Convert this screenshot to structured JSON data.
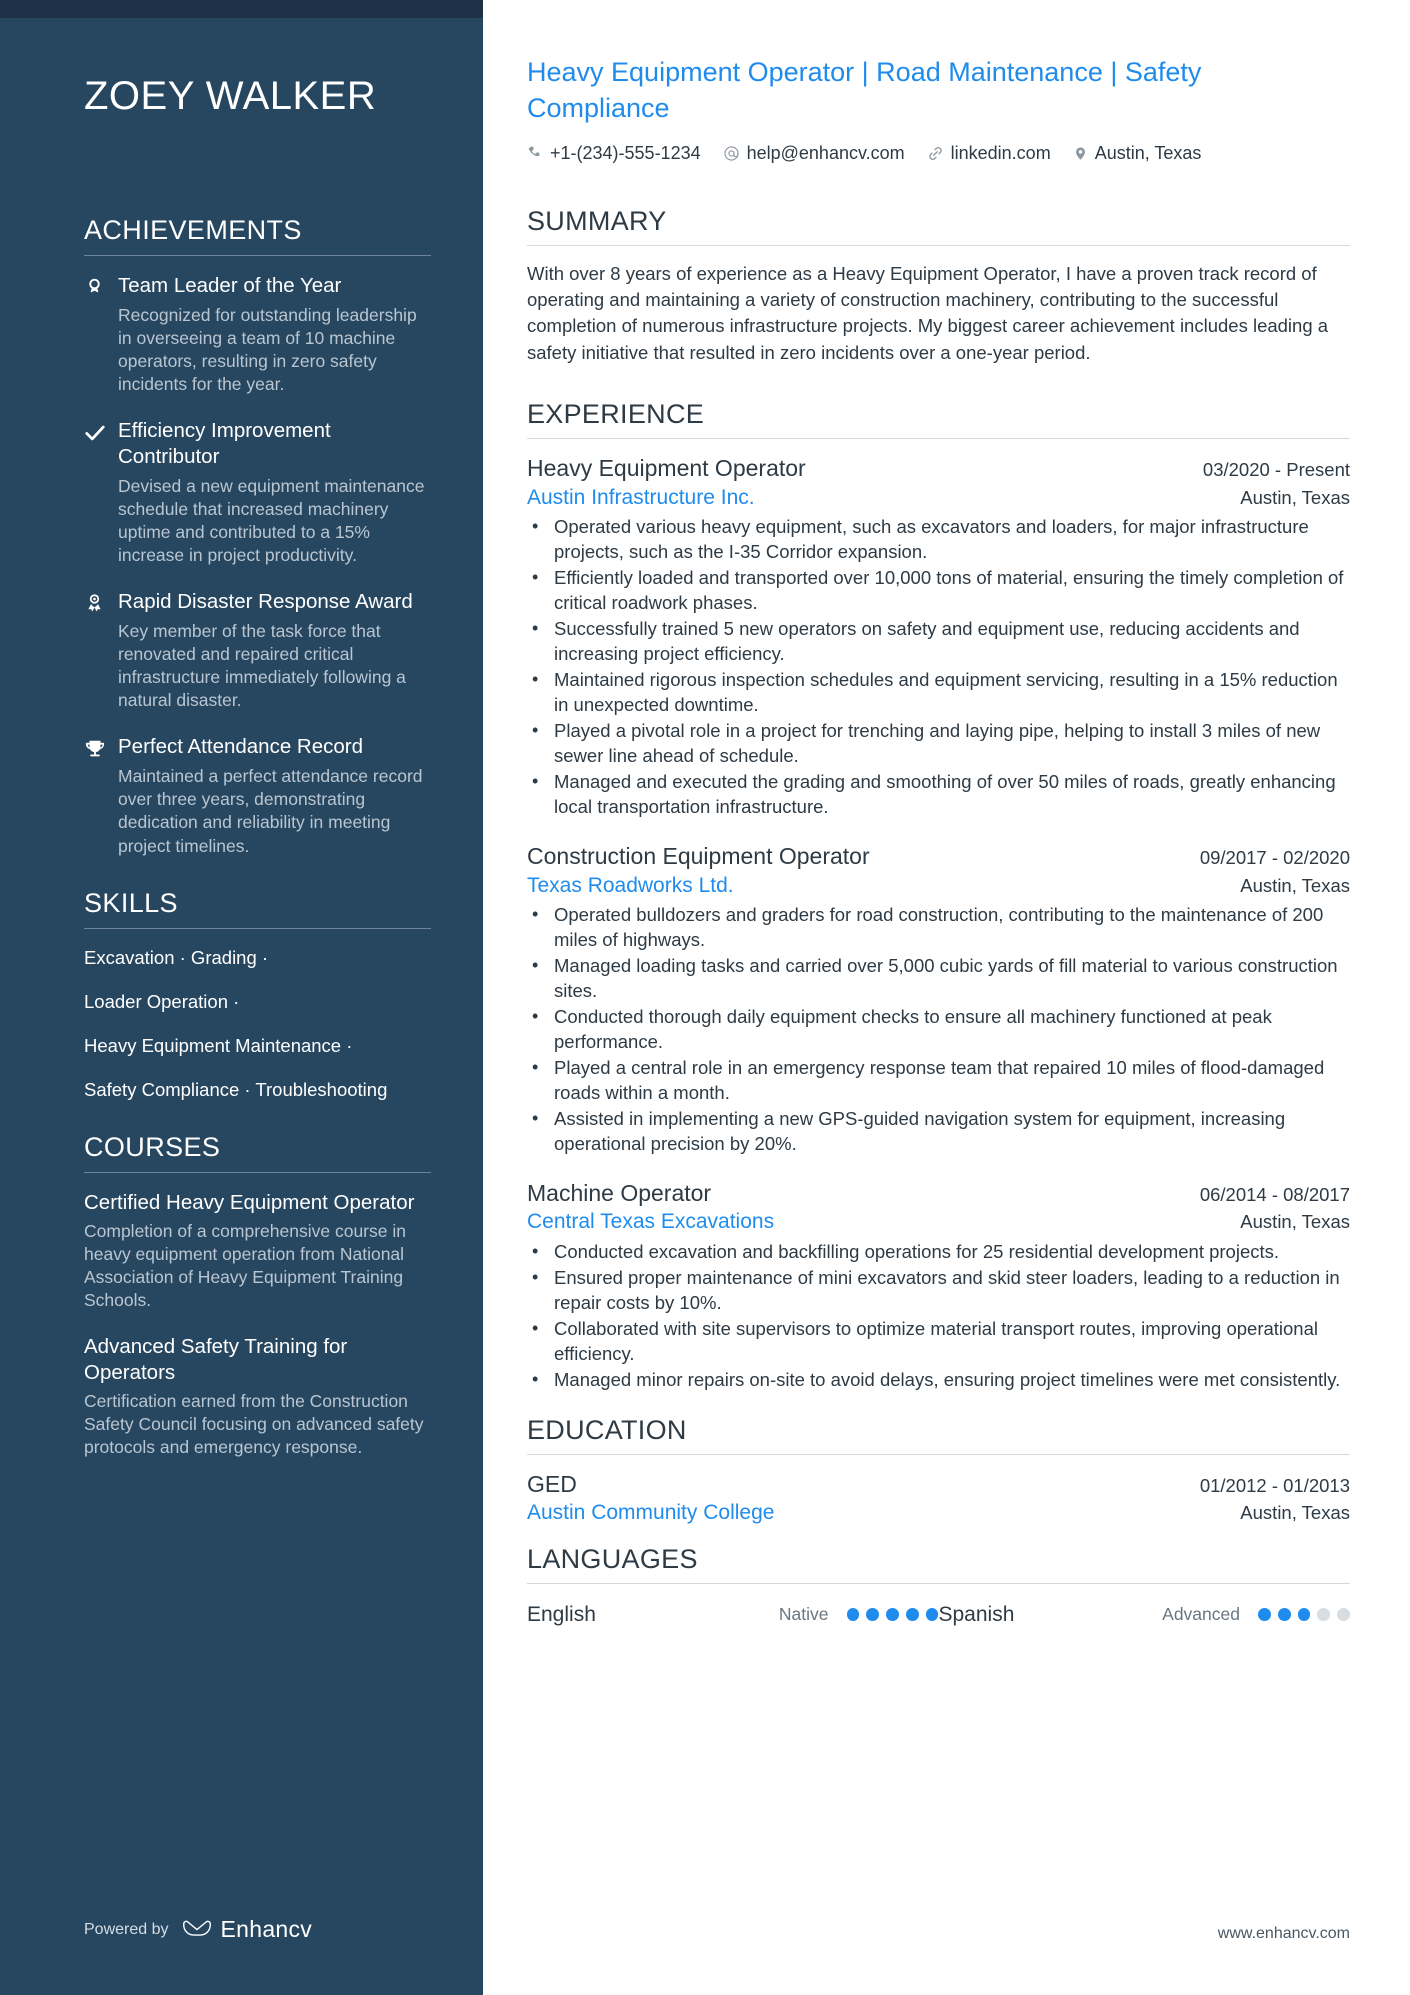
{
  "sidebar": {
    "name": "ZOEY WALKER",
    "achievements": {
      "heading": "ACHIEVEMENTS",
      "items": [
        {
          "icon": "medal-head-icon",
          "title": "Team Leader of the Year",
          "desc": "Recognized for outstanding leadership in overseeing a team of 10 machine operators, resulting in zero safety incidents for the year."
        },
        {
          "icon": "check-icon",
          "title": "Efficiency Improvement Contributor",
          "desc": "Devised a new equipment maintenance schedule that increased machinery uptime and contributed to a 15% increase in project productivity."
        },
        {
          "icon": "award-ribbon-icon",
          "title": "Rapid Disaster Response Award",
          "desc": "Key member of the task force that renovated and repaired critical infrastructure immediately following a natural disaster."
        },
        {
          "icon": "trophy-icon",
          "title": "Perfect Attendance Record",
          "desc": "Maintained a perfect attendance record over three years, demonstrating dedication and reliability in meeting project timelines."
        }
      ]
    },
    "skills": {
      "heading": "SKILLS",
      "lines": [
        "Excavation · Grading ·",
        "Loader Operation ·",
        "Heavy Equipment Maintenance ·",
        "Safety Compliance · Troubleshooting"
      ]
    },
    "courses": {
      "heading": "COURSES",
      "items": [
        {
          "title": "Certified Heavy Equipment Operator",
          "desc": "Completion of a comprehensive course in heavy equipment operation from National Association of Heavy Equipment Training Schools."
        },
        {
          "title": "Advanced Safety Training for Operators",
          "desc": "Certification earned from the Construction Safety Council focusing on advanced safety protocols and emergency response."
        }
      ]
    },
    "powered": {
      "label": "Powered by",
      "brand": "Enhancv"
    }
  },
  "main": {
    "headline": "Heavy Equipment Operator | Road Maintenance | Safety Compliance",
    "contacts": [
      {
        "icon": "phone-icon",
        "text": "+1-(234)-555-1234"
      },
      {
        "icon": "email-icon",
        "text": "help@enhancv.com"
      },
      {
        "icon": "link-icon",
        "text": "linkedin.com"
      },
      {
        "icon": "location-pin-icon",
        "text": "Austin, Texas"
      }
    ],
    "summary": {
      "heading": "SUMMARY",
      "text": "With over 8 years of experience as a Heavy Equipment Operator, I have a proven track record of operating and maintaining a variety of construction machinery, contributing to the successful completion of numerous infrastructure projects. My biggest career achievement includes leading a safety initiative that resulted in zero incidents over a one-year period."
    },
    "experience": {
      "heading": "EXPERIENCE",
      "jobs": [
        {
          "title": "Heavy Equipment Operator",
          "date": "03/2020 - Present",
          "company": "Austin Infrastructure Inc.",
          "location": "Austin, Texas",
          "bullets": [
            "Operated various heavy equipment, such as excavators and loaders, for major infrastructure projects, such as the I-35 Corridor expansion.",
            "Efficiently loaded and transported over 10,000 tons of material, ensuring the timely completion of critical roadwork phases.",
            "Successfully trained 5 new operators on safety and equipment use, reducing accidents and increasing project efficiency.",
            "Maintained rigorous inspection schedules and equipment servicing, resulting in a 15% reduction in unexpected downtime.",
            "Played a pivotal role in a project for trenching and laying pipe, helping to install 3 miles of new sewer line ahead of schedule.",
            "Managed and executed the grading and smoothing of over 50 miles of roads, greatly enhancing local transportation infrastructure."
          ]
        },
        {
          "title": "Construction Equipment Operator",
          "date": "09/2017 - 02/2020",
          "company": "Texas Roadworks Ltd.",
          "location": "Austin, Texas",
          "bullets": [
            "Operated bulldozers and graders for road construction, contributing to the maintenance of 200 miles of highways.",
            "Managed loading tasks and carried over 5,000 cubic yards of fill material to various construction sites.",
            "Conducted thorough daily equipment checks to ensure all machinery functioned at peak performance.",
            "Played a central role in an emergency response team that repaired 10 miles of flood-damaged roads within a month.",
            "Assisted in implementing a new GPS-guided navigation system for equipment, increasing operational precision by 20%."
          ]
        },
        {
          "title": "Machine Operator",
          "date": "06/2014 - 08/2017",
          "company": "Central Texas Excavations",
          "location": "Austin, Texas",
          "bullets": [
            "Conducted excavation and backfilling operations for 25 residential development projects.",
            "Ensured proper maintenance of mini excavators and skid steer loaders, leading to a reduction in repair costs by 10%.",
            "Collaborated with site supervisors to optimize material transport routes, improving operational efficiency.",
            "Managed minor repairs on-site to avoid delays, ensuring project timelines were met consistently."
          ]
        }
      ]
    },
    "education": {
      "heading": "EDUCATION",
      "items": [
        {
          "degree": "GED",
          "date": "01/2012 - 01/2013",
          "school": "Austin Community College",
          "location": "Austin, Texas"
        }
      ]
    },
    "languages": {
      "heading": "LANGUAGES",
      "items": [
        {
          "name": "English",
          "level": "Native",
          "filled": 5,
          "total": 5
        },
        {
          "name": "Spanish",
          "level": "Advanced",
          "filled": 3,
          "total": 5
        }
      ]
    },
    "site_url": "www.enhancv.com"
  },
  "colors": {
    "sidebar_bg": "#27465f",
    "sidebar_topbar": "#1d3246",
    "accent_blue": "#1f8ced",
    "text_dark": "#2e3a44",
    "muted": "#b9c6d1"
  }
}
